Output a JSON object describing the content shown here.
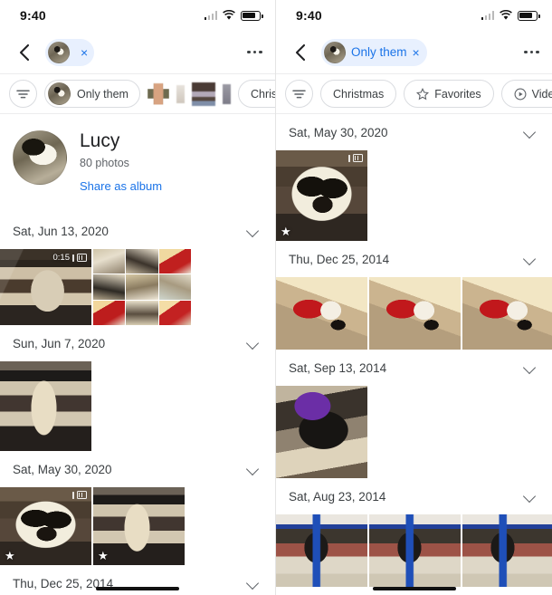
{
  "meta": {
    "accent_blue": "#1a73e8",
    "chip_bg_blue": "#e8f0fe",
    "text_primary": "#202124",
    "text_secondary": "#5f6368"
  },
  "left_screen": {
    "status_bar": {
      "time": "9:40",
      "signal_icon": "signal-bars-icon",
      "wifi_icon": "wifi-icon",
      "battery_icon": "battery-icon"
    },
    "app_bar": {
      "back_icon": "back-arrow-icon",
      "person_chip": {
        "avatar_icon": "dog-avatar",
        "label": "",
        "remove_icon": "×"
      },
      "overflow_icon": "more-options-icon"
    },
    "filter_chips": [
      {
        "name": "filter-settings",
        "type": "icon",
        "icon": "filter-tune-icon",
        "label": ""
      },
      {
        "name": "only-them",
        "type": "avatar",
        "label": "Only them"
      },
      {
        "name": "face-thumb-1",
        "type": "face",
        "label": ""
      },
      {
        "name": "face-thumb-2",
        "type": "face",
        "label": ""
      },
      {
        "name": "face-thumb-3",
        "type": "face",
        "label": ""
      },
      {
        "name": "face-thumb-4",
        "type": "face",
        "label": ""
      },
      {
        "name": "christmas",
        "type": "text",
        "label": "Christmas"
      }
    ],
    "person_header": {
      "avatar_icon": "dog-portrait-avatar",
      "name": "Lucy",
      "photo_count": "80 photos",
      "share_link": "Share as album"
    },
    "groups": [
      {
        "date": "Sat, Jun 13, 2020",
        "chevron_icon": "chevron-down-icon",
        "photos": [
          {
            "name": "video-thumb-dog-hallway",
            "duration": "0:15",
            "badge_icon": "burst-icon",
            "favorite": false
          },
          {
            "name": "photo-grid-nine-thumbs",
            "duration": "",
            "badge_icon": "",
            "favorite": false
          }
        ]
      },
      {
        "date": "Sun, Jun 7, 2020",
        "chevron_icon": "chevron-down-icon",
        "photos": [
          {
            "name": "photo-dog-on-rug",
            "duration": "",
            "badge_icon": "",
            "favorite": false
          }
        ]
      },
      {
        "date": "Sat, May 30, 2020",
        "chevron_icon": "chevron-down-icon",
        "photos": [
          {
            "name": "photo-dog-face-closeup",
            "duration": "",
            "badge_icon": "burst-icon",
            "favorite": true
          },
          {
            "name": "photo-dog-standing-rug",
            "duration": "",
            "badge_icon": "",
            "favorite": true
          }
        ]
      },
      {
        "date": "Thu, Dec 25, 2014",
        "chevron_icon": "chevron-down-icon",
        "photos": []
      }
    ]
  },
  "right_screen": {
    "status_bar": {
      "time": "9:40",
      "signal_icon": "signal-bars-icon",
      "wifi_icon": "wifi-icon",
      "battery_icon": "battery-icon"
    },
    "app_bar": {
      "back_icon": "back-arrow-icon",
      "person_chip": {
        "avatar_icon": "dog-avatar",
        "label": "Only them",
        "remove_icon": "×"
      },
      "overflow_icon": "more-options-icon"
    },
    "filter_chips": [
      {
        "name": "filter-settings",
        "type": "icon",
        "icon": "filter-tune-icon",
        "label": ""
      },
      {
        "name": "christmas",
        "type": "text",
        "label": "Christmas"
      },
      {
        "name": "favorites",
        "type": "star",
        "label": "Favorites"
      },
      {
        "name": "videos",
        "type": "play",
        "label": "Videos"
      },
      {
        "name": "people",
        "type": "person",
        "label": ""
      }
    ],
    "groups": [
      {
        "date": "Sat, May 30, 2020",
        "chevron_icon": "chevron-down-icon",
        "photos": [
          {
            "name": "photo-dog-face-closeup",
            "duration": "",
            "badge_icon": "burst-icon",
            "favorite": true
          }
        ]
      },
      {
        "date": "Thu, Dec 25, 2014",
        "chevron_icon": "chevron-down-icon",
        "photos": [
          {
            "name": "photo-dog-santa-sweater-1",
            "duration": "",
            "badge_icon": "",
            "favorite": false
          },
          {
            "name": "photo-dog-santa-sweater-2",
            "duration": "",
            "badge_icon": "",
            "favorite": false
          },
          {
            "name": "photo-dog-santa-sweater-3",
            "duration": "",
            "badge_icon": "",
            "favorite": false
          }
        ]
      },
      {
        "date": "Sat, Sep 13, 2014",
        "chevron_icon": "chevron-down-icon",
        "photos": [
          {
            "name": "photo-dog-purple-blanket",
            "duration": "",
            "badge_icon": "",
            "favorite": false
          }
        ]
      },
      {
        "date": "Sat, Aug 23, 2014",
        "chevron_icon": "chevron-down-icon",
        "photos": [
          {
            "name": "photo-dog-leash-1",
            "duration": "",
            "badge_icon": "",
            "favorite": false
          },
          {
            "name": "photo-dog-leash-2",
            "duration": "",
            "badge_icon": "",
            "favorite": false
          },
          {
            "name": "photo-dog-leash-3",
            "duration": "",
            "badge_icon": "",
            "favorite": false
          }
        ]
      }
    ]
  }
}
